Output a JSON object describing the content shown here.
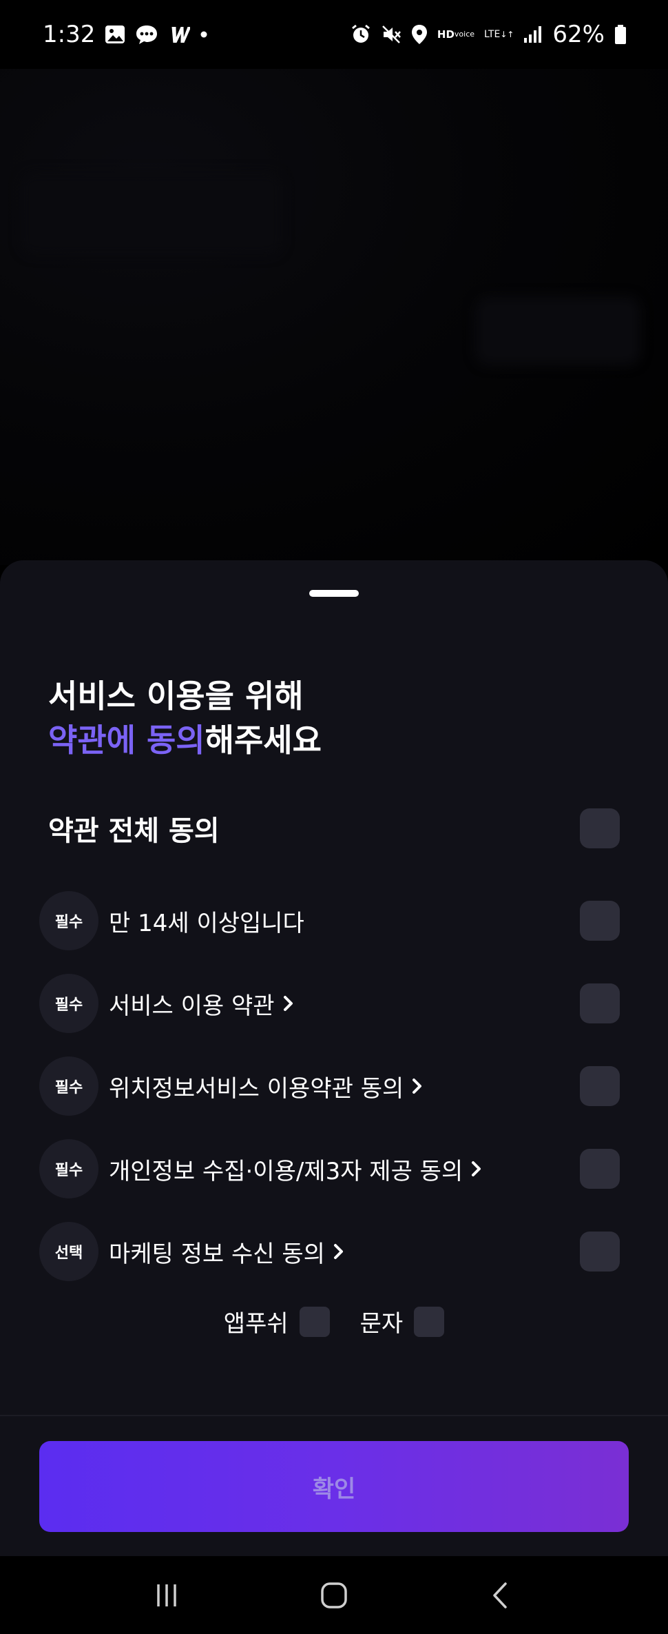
{
  "status_bar": {
    "time": "1:32",
    "battery_percent": "62%",
    "icons_left": [
      "gallery-icon",
      "chat-icon",
      "w-icon",
      "dot-icon"
    ],
    "icons_right": [
      "alarm-icon",
      "mute-icon",
      "location-icon",
      "hd-voice-icon",
      "lte-icon",
      "signal-icon",
      "battery-icon"
    ],
    "hd_label": "HD",
    "voice_label": "voice",
    "lte_label": "LTE"
  },
  "sheet": {
    "title_line1": "서비스 이용을 위해",
    "title_accent": "약관에 동의",
    "title_rest": "해주세요",
    "accent_color": "#7b63f5",
    "all_agree_label": "약관 전체 동의",
    "terms": [
      {
        "badge": "필수",
        "label": "만 14세 이상입니다",
        "has_link": false
      },
      {
        "badge": "필수",
        "label": "서비스 이용 약관",
        "has_link": true
      },
      {
        "badge": "필수",
        "label": "위치정보서비스 이용약관 동의",
        "has_link": true
      },
      {
        "badge": "필수",
        "label": "개인정보 수집·이용/제3자 제공 동의",
        "has_link": true
      },
      {
        "badge": "선택",
        "label": "마케팅 정보 수신 동의",
        "has_link": true
      }
    ],
    "channels": [
      {
        "label": "앱푸쉬"
      },
      {
        "label": "문자"
      }
    ],
    "confirm_label": "확인"
  },
  "nav_bar": {
    "buttons": [
      "recent-apps-icon",
      "home-icon",
      "back-icon"
    ]
  }
}
